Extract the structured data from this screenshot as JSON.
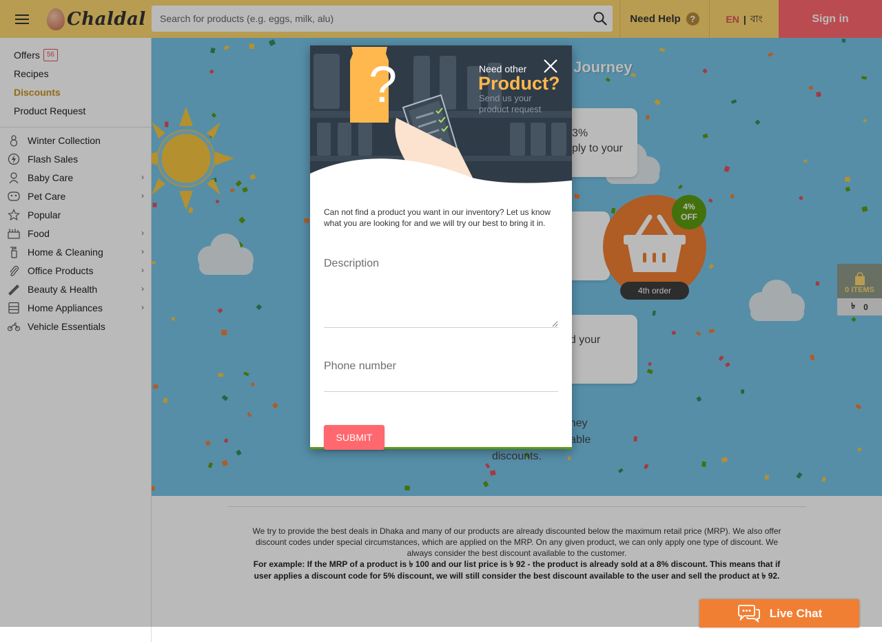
{
  "header": {
    "logo_text": "Chaldal",
    "search_placeholder": "Search for products (e.g. eggs, milk, alu)",
    "need_help": "Need Help",
    "help_icon_glyph": "?",
    "lang_en": "EN",
    "lang_sep": "|",
    "lang_bn": "বাং",
    "sign_in": "Sign in"
  },
  "sidebar": {
    "top_links": [
      {
        "label": "Offers",
        "badge": "56"
      },
      {
        "label": "Recipes"
      },
      {
        "label": "Discounts",
        "active": true
      },
      {
        "label": "Product Request"
      }
    ],
    "categories": [
      {
        "label": "Winter Collection",
        "icon": "snowman-icon",
        "has_children": false
      },
      {
        "label": "Flash Sales",
        "icon": "lightning-icon",
        "has_children": false
      },
      {
        "label": "Baby Care",
        "icon": "baby-icon",
        "has_children": true
      },
      {
        "label": "Pet Care",
        "icon": "pet-icon",
        "has_children": true
      },
      {
        "label": "Popular",
        "icon": "star-icon",
        "has_children": false
      },
      {
        "label": "Food",
        "icon": "food-icon",
        "has_children": true
      },
      {
        "label": "Home & Cleaning",
        "icon": "spray-icon",
        "has_children": true
      },
      {
        "label": "Office Products",
        "icon": "paperclip-icon",
        "has_children": true
      },
      {
        "label": "Beauty & Health",
        "icon": "comb-icon",
        "has_children": true
      },
      {
        "label": "Home Appliances",
        "icon": "appliance-icon",
        "has_children": true
      },
      {
        "label": "Vehicle Essentials",
        "icon": "motorbike-icon",
        "has_children": false
      }
    ]
  },
  "hero": {
    "title_fragment": "Journey",
    "card1_line1": "3%",
    "card1_line2": "ply to your",
    "card3_line1": "nd your",
    "off_badge_pct": "4%",
    "off_badge_label": "OFF",
    "order_pill": "4th order",
    "journey_line1": "journey",
    "journey_line2": "ilable",
    "journey_line3": "discounts."
  },
  "footer_note": {
    "paragraph": "We try to provide the best deals in Dhaka and many of our products are already discounted below the maximum retail price (MRP). We also offer discount codes under special circumstances, which are applied on the MRP. On any given product, we can only apply one type of discount. We always consider the best discount available to the customer.",
    "example": "For example: If the MRP of a product is ৳ 100 and our list price is ৳ 92 - the product is already sold at a 8% discount. This means that if user applies a discount code for 5% discount, we will still consider the best discount available to the user and sell the product at ৳ 92."
  },
  "cart": {
    "items_label": "0 ITEMS",
    "currency": "৳",
    "amount": "0"
  },
  "live_chat": {
    "label": "Live Chat"
  },
  "modal": {
    "question_mark": "?",
    "title_small": "Need other",
    "title_big": "Product?",
    "subtitle": "Send us your product request",
    "intro": "Can not find a product you want in our inventory? Let us know what you are looking for and we will try our best to bring it in.",
    "description_label": "Description",
    "phone_label": "Phone number",
    "submit_label": "SUBMIT"
  },
  "colors": {
    "header_bg": "#fdd670",
    "sign_in_bg": "#ff686e",
    "hero_bg": "#76c3e6",
    "accent_orange": "#f07f34",
    "accent_green": "#5d9b11",
    "discounts_link": "#c8951c"
  }
}
